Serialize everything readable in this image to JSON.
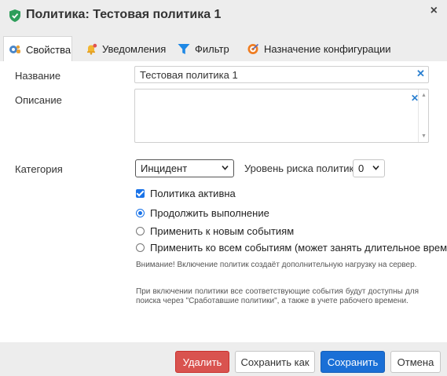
{
  "dialog": {
    "title": "Политика: Тестовая политика 1",
    "close_label": "×"
  },
  "tabs": [
    {
      "label": "Свойства",
      "icon": "gear-users-icon",
      "active": true
    },
    {
      "label": "Уведомления",
      "icon": "bell-icon",
      "active": false
    },
    {
      "label": "Фильтр",
      "icon": "filter-icon",
      "active": false
    },
    {
      "label": "Назначение конфигурации",
      "icon": "target-icon",
      "active": false
    }
  ],
  "form": {
    "name_label": "Название",
    "name_value": "Тестовая политика 1",
    "description_label": "Описание",
    "description_value": "",
    "category_label": "Категория",
    "category_value": "Инцидент",
    "risk_label": "Уровень риска политики",
    "risk_value": "0",
    "active_label": "Политика активна",
    "radio_options": [
      {
        "label": "Продолжить выполнение",
        "checked": true
      },
      {
        "label": "Применить к новым событиям",
        "checked": false
      },
      {
        "label": "Применить ко всем событиям (может занять длительное время)",
        "checked": false
      }
    ],
    "note1": "Внимание! Включение политик создаёт дополнительную нагрузку на сервер.",
    "note2": "При включении политики все соответствующие события будут доступны для поиска через \"Сработавшие политики\", а также в учете рабочего времени."
  },
  "buttons": {
    "delete": "Удалить",
    "save_as": "Сохранить как",
    "save": "Сохранить",
    "cancel": "Отмена"
  },
  "colors": {
    "primary": "#1a6fd6",
    "danger": "#d9534f",
    "checkbox": "#1a73e8",
    "clear_icon": "#2a7fd0"
  }
}
